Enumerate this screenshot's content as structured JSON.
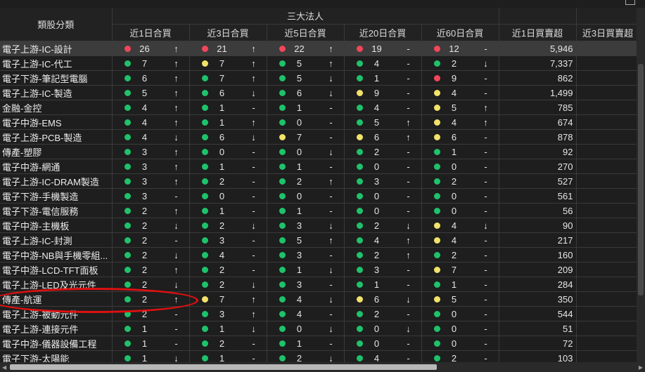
{
  "header": {
    "category_label": "類股分類",
    "group_label": "三大法人",
    "period_columns": [
      "近1日合買",
      "近3日合買",
      "近5日合買",
      "近20日合買",
      "近60日合買"
    ],
    "value_column": "近1日買賣超",
    "partial_column": "近3日買賣超"
  },
  "colors": {
    "green": "#1ec26b",
    "yellow": "#f2e26a",
    "red": "#f2465a",
    "annotation": "#e01010"
  },
  "annotation": {
    "target_row": "傳產-航運",
    "shape": "red-ellipse"
  },
  "rows": [
    {
      "name": "電子上游-IC-設計",
      "cells": [
        [
          "red",
          "26",
          "↑"
        ],
        [
          "red",
          "21",
          "↑"
        ],
        [
          "red",
          "22",
          "↑"
        ],
        [
          "red",
          "19",
          "-"
        ],
        [
          "red",
          "12",
          "-"
        ]
      ],
      "value": "5,946",
      "selected": true
    },
    {
      "name": "電子上游-IC-代工",
      "cells": [
        [
          "green",
          "7",
          "↑"
        ],
        [
          "yellow",
          "7",
          "↑"
        ],
        [
          "green",
          "5",
          "↑"
        ],
        [
          "green",
          "4",
          "-"
        ],
        [
          "green",
          "2",
          "↓"
        ]
      ],
      "value": "7,337"
    },
    {
      "name": "電子下游-筆記型電腦",
      "cells": [
        [
          "green",
          "6",
          "↑"
        ],
        [
          "green",
          "7",
          "↑"
        ],
        [
          "green",
          "5",
          "↓"
        ],
        [
          "green",
          "1",
          "-"
        ],
        [
          "red",
          "9",
          "-"
        ]
      ],
      "value": "862"
    },
    {
      "name": "電子上游-IC-製造",
      "cells": [
        [
          "green",
          "5",
          "↑"
        ],
        [
          "green",
          "6",
          "↓"
        ],
        [
          "green",
          "6",
          "↓"
        ],
        [
          "yellow",
          "9",
          "-"
        ],
        [
          "yellow",
          "4",
          "-"
        ]
      ],
      "value": "1,499"
    },
    {
      "name": "金融-金控",
      "cells": [
        [
          "green",
          "4",
          "↑"
        ],
        [
          "green",
          "1",
          "-"
        ],
        [
          "green",
          "1",
          "-"
        ],
        [
          "green",
          "4",
          "-"
        ],
        [
          "yellow",
          "5",
          "↑"
        ]
      ],
      "value": "785"
    },
    {
      "name": "電子中游-EMS",
      "cells": [
        [
          "green",
          "4",
          "↑"
        ],
        [
          "green",
          "1",
          "↑"
        ],
        [
          "green",
          "0",
          "-"
        ],
        [
          "green",
          "5",
          "↑"
        ],
        [
          "yellow",
          "4",
          "↑"
        ]
      ],
      "value": "674"
    },
    {
      "name": "電子上游-PCB-製造",
      "cells": [
        [
          "green",
          "4",
          "↓"
        ],
        [
          "green",
          "6",
          "↓"
        ],
        [
          "yellow",
          "7",
          "-"
        ],
        [
          "yellow",
          "6",
          "↑"
        ],
        [
          "yellow",
          "6",
          "-"
        ]
      ],
      "value": "878"
    },
    {
      "name": "傳產-塑膠",
      "cells": [
        [
          "green",
          "3",
          "↑"
        ],
        [
          "green",
          "0",
          "-"
        ],
        [
          "green",
          "0",
          "↓"
        ],
        [
          "green",
          "2",
          "-"
        ],
        [
          "green",
          "1",
          "-"
        ]
      ],
      "value": "92"
    },
    {
      "name": "電子中游-網通",
      "cells": [
        [
          "green",
          "3",
          "↑"
        ],
        [
          "green",
          "1",
          "-"
        ],
        [
          "green",
          "1",
          "-"
        ],
        [
          "green",
          "0",
          "-"
        ],
        [
          "green",
          "0",
          "-"
        ]
      ],
      "value": "270"
    },
    {
      "name": "電子上游-IC-DRAM製造",
      "cells": [
        [
          "green",
          "3",
          "↑"
        ],
        [
          "green",
          "2",
          "-"
        ],
        [
          "green",
          "2",
          "↑"
        ],
        [
          "green",
          "3",
          "-"
        ],
        [
          "green",
          "2",
          "-"
        ]
      ],
      "value": "527"
    },
    {
      "name": "電子下游-手機製造",
      "cells": [
        [
          "green",
          "3",
          "-"
        ],
        [
          "green",
          "0",
          "-"
        ],
        [
          "green",
          "0",
          "-"
        ],
        [
          "green",
          "0",
          "-"
        ],
        [
          "green",
          "0",
          "-"
        ]
      ],
      "value": "561"
    },
    {
      "name": "電子下游-電信服務",
      "cells": [
        [
          "green",
          "2",
          "↑"
        ],
        [
          "green",
          "1",
          "-"
        ],
        [
          "green",
          "1",
          "-"
        ],
        [
          "green",
          "0",
          "-"
        ],
        [
          "green",
          "0",
          "-"
        ]
      ],
      "value": "56"
    },
    {
      "name": "電子中游-主機板",
      "cells": [
        [
          "green",
          "2",
          "↓"
        ],
        [
          "green",
          "2",
          "↓"
        ],
        [
          "green",
          "3",
          "↓"
        ],
        [
          "green",
          "2",
          "↓"
        ],
        [
          "yellow",
          "4",
          "↓"
        ]
      ],
      "value": "90"
    },
    {
      "name": "電子上游-IC-封測",
      "cells": [
        [
          "green",
          "2",
          "-"
        ],
        [
          "green",
          "3",
          "-"
        ],
        [
          "green",
          "5",
          "↑"
        ],
        [
          "green",
          "4",
          "↑"
        ],
        [
          "yellow",
          "4",
          "-"
        ]
      ],
      "value": "217"
    },
    {
      "name": "電子中游-NB與手機零組...",
      "cells": [
        [
          "green",
          "2",
          "↓"
        ],
        [
          "green",
          "4",
          "-"
        ],
        [
          "green",
          "3",
          "-"
        ],
        [
          "green",
          "2",
          "↑"
        ],
        [
          "green",
          "2",
          "-"
        ]
      ],
      "value": "160"
    },
    {
      "name": "電子中游-LCD-TFT面板",
      "cells": [
        [
          "green",
          "2",
          "↑"
        ],
        [
          "green",
          "2",
          "-"
        ],
        [
          "green",
          "1",
          "↓"
        ],
        [
          "green",
          "3",
          "-"
        ],
        [
          "yellow",
          "7",
          "-"
        ]
      ],
      "value": "209"
    },
    {
      "name": "電子上游-LED及光元件",
      "cells": [
        [
          "green",
          "2",
          "↓"
        ],
        [
          "green",
          "2",
          "↓"
        ],
        [
          "green",
          "3",
          "-"
        ],
        [
          "green",
          "1",
          "-"
        ],
        [
          "green",
          "1",
          "-"
        ]
      ],
      "value": "284"
    },
    {
      "name": "傳產-航運",
      "cells": [
        [
          "green",
          "2",
          "↑"
        ],
        [
          "yellow",
          "7",
          "↑"
        ],
        [
          "green",
          "4",
          "↓"
        ],
        [
          "yellow",
          "6",
          "↓"
        ],
        [
          "yellow",
          "5",
          "-"
        ]
      ],
      "value": "350"
    },
    {
      "name": "電子上游-被動元件",
      "cells": [
        [
          "green",
          "2",
          "-"
        ],
        [
          "green",
          "3",
          "↑"
        ],
        [
          "green",
          "4",
          "-"
        ],
        [
          "green",
          "2",
          "-"
        ],
        [
          "green",
          "0",
          "-"
        ]
      ],
      "value": "544"
    },
    {
      "name": "電子上游-連接元件",
      "cells": [
        [
          "green",
          "1",
          "-"
        ],
        [
          "green",
          "1",
          "↓"
        ],
        [
          "green",
          "0",
          "↓"
        ],
        [
          "green",
          "0",
          "↓"
        ],
        [
          "green",
          "0",
          "-"
        ]
      ],
      "value": "51"
    },
    {
      "name": "電子中游-儀器設備工程",
      "cells": [
        [
          "green",
          "1",
          "-"
        ],
        [
          "green",
          "2",
          "-"
        ],
        [
          "green",
          "1",
          "-"
        ],
        [
          "green",
          "0",
          "-"
        ],
        [
          "green",
          "0",
          "-"
        ]
      ],
      "value": "72"
    },
    {
      "name": "電子下游-太陽能",
      "cells": [
        [
          "green",
          "1",
          "↓"
        ],
        [
          "green",
          "1",
          "-"
        ],
        [
          "green",
          "2",
          "↓"
        ],
        [
          "green",
          "4",
          "-"
        ],
        [
          "green",
          "2",
          "-"
        ]
      ],
      "value": "103"
    }
  ]
}
